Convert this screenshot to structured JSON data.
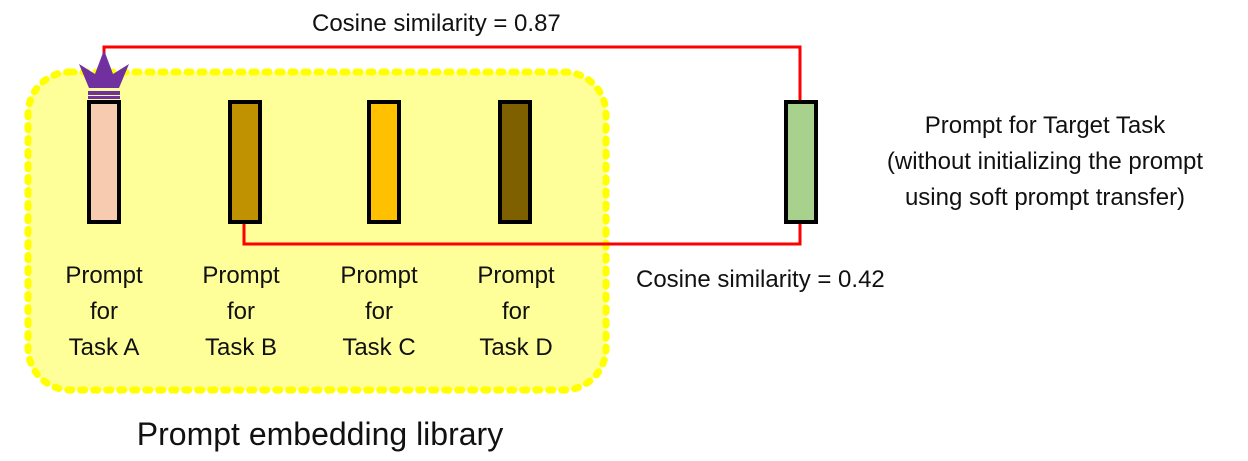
{
  "similarity_top": "Cosine similarity = 0.87",
  "similarity_bottom": "Cosine similarity = 0.42",
  "library_label": "Prompt embedding library",
  "prompts": [
    {
      "line1": "Prompt",
      "line2": "for",
      "line3": "Task A",
      "color": "#f7cbb0"
    },
    {
      "line1": "Prompt",
      "line2": "for",
      "line3": "Task B",
      "color": "#c09100"
    },
    {
      "line1": "Prompt",
      "line2": "for",
      "line3": "Task C",
      "color": "#ffc000"
    },
    {
      "line1": "Prompt",
      "line2": "for",
      "line3": "Task D",
      "color": "#7f6000"
    }
  ],
  "target": {
    "line1": "Prompt for Target Task",
    "line2": "(without initializing the prompt",
    "line3": "using soft prompt transfer)",
    "color": "#a9d18e"
  },
  "colors": {
    "library_fill": "#ffff99",
    "library_border": "#ffff00",
    "connector": "#ff0000",
    "crown": "#7030a0"
  },
  "icons": {
    "best_match": "crown-icon"
  }
}
